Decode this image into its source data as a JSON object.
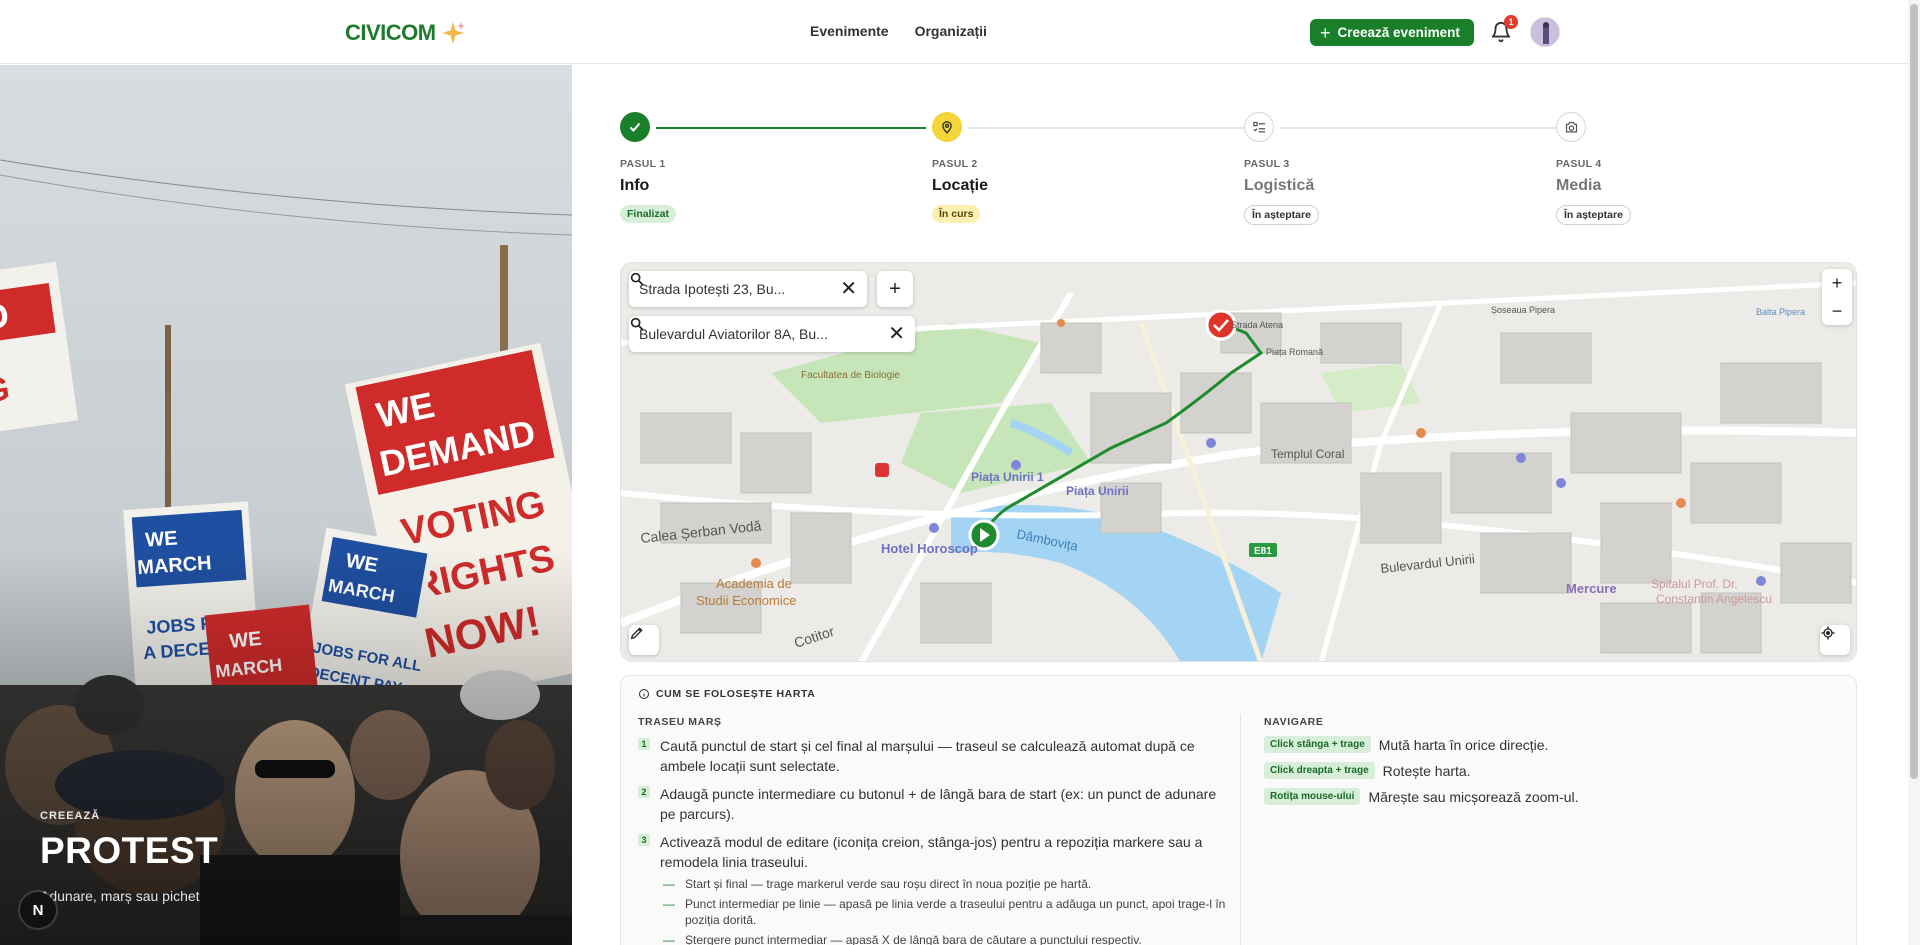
{
  "header": {
    "logo": "CIVICOM",
    "nav": [
      "Evenimente",
      "Organizații"
    ],
    "create_button": "Creează eveniment",
    "notification_count": "1"
  },
  "hero": {
    "eyebrow": "CREEAZĂ",
    "title": "PROTEST",
    "subtitle": "Adunare, marș sau pichet",
    "sign_texts": [
      "WE DEMAND",
      "VOTING RIGHTS NOW!",
      "WE MARCH FOR JOBS FOR A DECENT",
      "WE MARCH FOR",
      "WE MARCH FOR JOBS FOR ALL DECENT PAY"
    ],
    "dev_badge": "N"
  },
  "stepper": [
    {
      "number": "PASUL 1",
      "name": "Info",
      "status": "Finalizat",
      "state": "done"
    },
    {
      "number": "PASUL 2",
      "name": "Locație",
      "status": "În curs",
      "state": "active"
    },
    {
      "number": "PASUL 3",
      "name": "Logistică",
      "status": "În așteptare",
      "state": "pending"
    },
    {
      "number": "PASUL 4",
      "name": "Media",
      "status": "În așteptare",
      "state": "pending"
    }
  ],
  "map": {
    "start_search": "Strada Ipotești 23, Bu...",
    "end_search": "Bulevardul Aviatorilor 8A, Bu...",
    "labels": [
      "Piața Unirii 1",
      "Piața Unirii",
      "Hotel Horoscop",
      "Calea Șerban Vodă",
      "Academia de Studii Economice",
      "Dâmbovița",
      "Bulevardul Unirii",
      "Mercure",
      "Spitalul Prof. Dr. Constantin Angelescu",
      "Templul Coral",
      "Facultatea de Biologie",
      "Piața Romană",
      "Strada Atena",
      "Șoseaua Pipera",
      "Balta Pipera",
      "Cotitor",
      "E81"
    ],
    "colors": {
      "route": "#1e8c2e",
      "water": "#9ed2f5",
      "park": "#bfe5b5",
      "start_marker": "#1e8c2e",
      "end_marker": "#e0342a"
    }
  },
  "help": {
    "title": "CUM SE FOLOSEȘTE HARTA",
    "route_title": "TRASEU MARȘ",
    "route_steps": [
      {
        "n": "1",
        "text": "Caută punctul de start și cel final al marșului — traseul se calculează automat după ce ambele locații sunt selectate."
      },
      {
        "n": "2",
        "text": "Adaugă puncte intermediare cu butonul + de lângă bara de start (ex: un punct de adunare pe parcurs)."
      },
      {
        "n": "3",
        "text": "Activează modul de editare (iconița creion, stânga-jos) pentru a repoziția markere sau a remodela linia traseului."
      }
    ],
    "edit_sub": [
      "Start și final — trage markerul verde sau roșu direct în noua poziție pe hartă.",
      "Punct intermediar pe linie — apasă pe linia verde a traseului pentru a adăuga un punct, apoi trage-l în poziția dorită.",
      "Ștergere punct intermediar — apasă X de lângă bara de căutare a punctului respectiv."
    ],
    "nav_title": "NAVIGARE",
    "nav_items": [
      {
        "key": "Click stânga + trage",
        "desc": "Mută harta în orice direcție."
      },
      {
        "key": "Click dreapta + trage",
        "desc": "Rotește harta."
      },
      {
        "key": "Rotița mouse-ului",
        "desc": "Mărește sau micșorează zoom-ul."
      }
    ]
  }
}
